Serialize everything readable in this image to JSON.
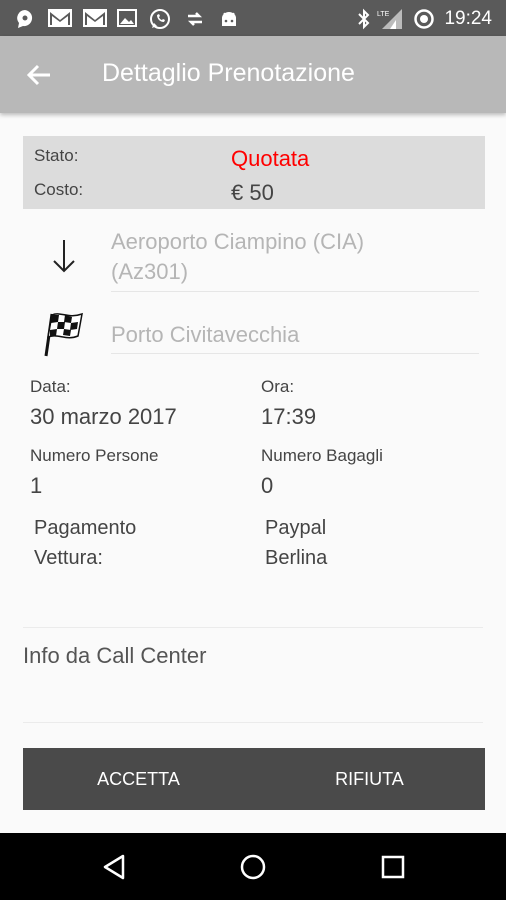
{
  "status_bar": {
    "time": "19:24",
    "icons": [
      "chat-bubble-icon",
      "gmail-icon",
      "gmail-icon",
      "image-icon",
      "whatsapp-icon",
      "transfer-icon",
      "android-icon",
      "bluetooth-icon",
      "lte-signal-icon",
      "sync-icon",
      "battery-icon"
    ]
  },
  "app_bar": {
    "title": "Dettaglio Prenotazione",
    "back_icon": "arrow-back-icon"
  },
  "status_card": {
    "stato_label": "Stato:",
    "stato_value": "Quotata",
    "costo_label": "Costo:",
    "costo_value": "€ 50",
    "stato_color": "#ff0000"
  },
  "route": {
    "departure_icon": "arrow-down-icon",
    "departure_line1": "Aeroporto Ciampino (CIA)",
    "departure_line2": "(Az301)",
    "arrival_icon": "checkered-flag-icon",
    "arrival": "Porto Civitavecchia"
  },
  "details": {
    "data_label": "Data:",
    "data_value": "30 marzo 2017",
    "ora_label": "Ora:",
    "ora_value": "17:39",
    "persone_label": "Numero Persone",
    "persone_value": "1",
    "bagagli_label": "Numero Bagagli",
    "bagagli_value": "0",
    "pagamento_label": "Pagamento",
    "pagamento_value": "Paypal",
    "vettura_label": "Vettura:",
    "vettura_value": "Berlina"
  },
  "info": {
    "label": "Info da Call Center"
  },
  "actions": {
    "accept": "ACCETTA",
    "reject": "RIFIUTA"
  },
  "nav_bar": {
    "back": "nav-back-icon",
    "home": "nav-home-icon",
    "recents": "nav-recents-icon"
  }
}
